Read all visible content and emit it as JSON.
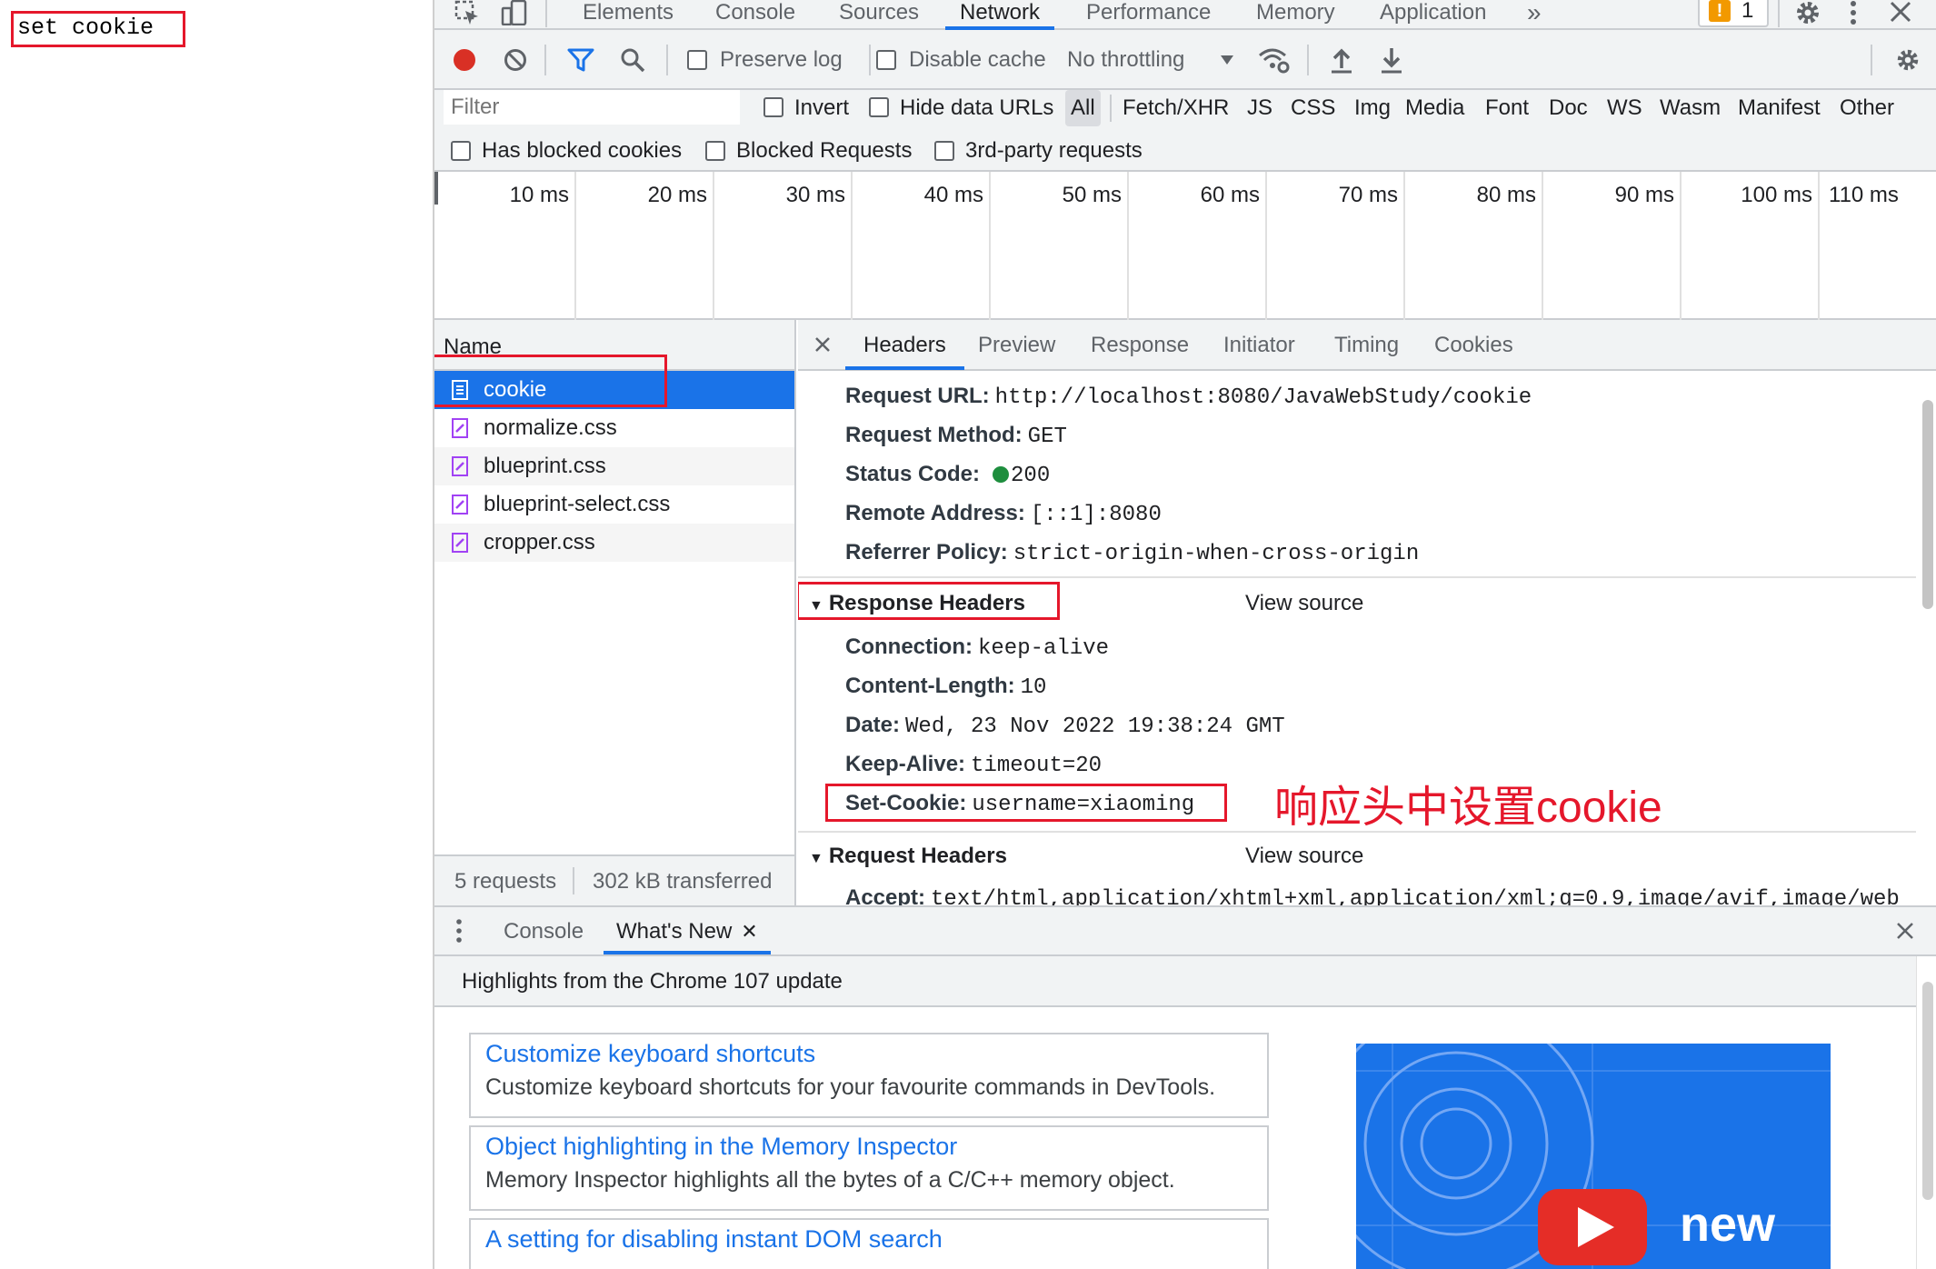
{
  "page": {
    "body_text": "set cookie"
  },
  "main_tabs": [
    "Elements",
    "Console",
    "Sources",
    "Network",
    "Performance",
    "Memory",
    "Application"
  ],
  "main_bar": {
    "more_tabs": "»",
    "issues_count": "1"
  },
  "network_toolbar": {
    "preserve_log": "Preserve log",
    "disable_cache": "Disable cache",
    "throttling": "No throttling"
  },
  "filter_bar": {
    "placeholder": "Filter",
    "invert": "Invert",
    "hide_data_urls": "Hide data URLs",
    "types": [
      "All",
      "Fetch/XHR",
      "JS",
      "CSS",
      "Img",
      "Media",
      "Font",
      "Doc",
      "WS",
      "Wasm",
      "Manifest",
      "Other"
    ],
    "has_blocked_cookies": "Has blocked cookies",
    "blocked_requests": "Blocked Requests",
    "third_party": "3rd-party requests"
  },
  "overview": {
    "ticks": [
      "10 ms",
      "20 ms",
      "30 ms",
      "40 ms",
      "50 ms",
      "60 ms",
      "70 ms",
      "80 ms",
      "90 ms",
      "100 ms",
      "110 ms"
    ]
  },
  "request_list": {
    "header": "Name",
    "items": [
      {
        "name": "cookie",
        "type": "document"
      },
      {
        "name": "normalize.css",
        "type": "stylesheet"
      },
      {
        "name": "blueprint.css",
        "type": "stylesheet"
      },
      {
        "name": "blueprint-select.css",
        "type": "stylesheet"
      },
      {
        "name": "cropper.css",
        "type": "stylesheet"
      }
    ],
    "summary_requests": "5 requests",
    "summary_transferred": "302 kB transferred"
  },
  "detail_tabs": [
    "Headers",
    "Preview",
    "Response",
    "Initiator",
    "Timing",
    "Cookies"
  ],
  "general": [
    {
      "key": "Request URL:",
      "value": "http://localhost:8080/JavaWebStudy/cookie"
    },
    {
      "key": "Request Method:",
      "value": "GET"
    },
    {
      "key": "Status Code:",
      "value": "200"
    },
    {
      "key": "Remote Address:",
      "value": "[::1]:8080"
    },
    {
      "key": "Referrer Policy:",
      "value": "strict-origin-when-cross-origin"
    }
  ],
  "response_headers": {
    "title": "Response Headers",
    "view_source": "View source",
    "rows": [
      {
        "key": "Connection:",
        "value": "keep-alive"
      },
      {
        "key": "Content-Length:",
        "value": "10"
      },
      {
        "key": "Date:",
        "value": "Wed, 23 Nov 2022 19:38:24 GMT"
      },
      {
        "key": "Keep-Alive:",
        "value": "timeout=20"
      },
      {
        "key": "Set-Cookie:",
        "value": "username=xiaoming"
      }
    ]
  },
  "annotation": "响应头中设置cookie",
  "request_headers": {
    "title": "Request Headers",
    "view_source": "View source",
    "rows": [
      {
        "key": "Accept:",
        "value": "text/html,application/xhtml+xml,application/xml;q=0.9,image/avif,image/web"
      }
    ]
  },
  "drawer": {
    "tabs": [
      "Console",
      "What's New"
    ],
    "highlights": "Highlights from the Chrome 107 update",
    "cards": [
      {
        "title": "Customize keyboard shortcuts",
        "desc": "Customize keyboard shortcuts for your favourite commands in DevTools."
      },
      {
        "title": "Object highlighting in the Memory Inspector",
        "desc": "Memory Inspector highlights all the bytes of a C/C++ memory object."
      },
      {
        "title": "A setting for disabling instant DOM search",
        "desc": ""
      }
    ],
    "promo_label": "new"
  },
  "colors": {
    "accent": "#1a73e8",
    "annotation_red": "#e5172b",
    "selected_row": "#1a73e8",
    "status_green": "#1e8e3e"
  }
}
